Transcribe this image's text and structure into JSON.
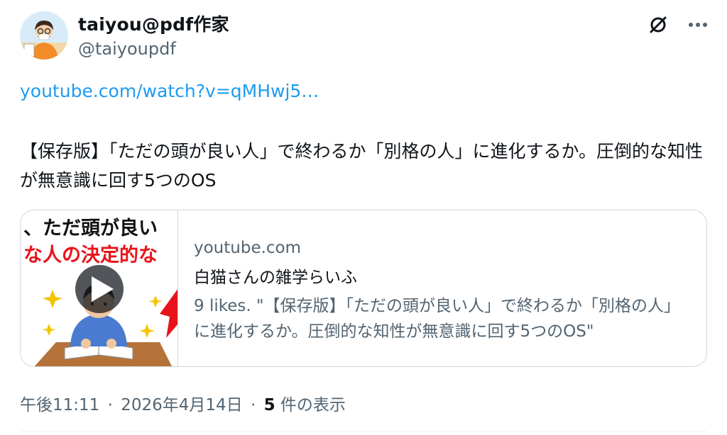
{
  "author": {
    "display_name": "taiyou@pdf作家",
    "handle": "@taiyoupdf"
  },
  "tweet": {
    "link_text": "youtube.com/watch?v=qMHwj5…",
    "text": "【保存版】「ただの頭が良い人」で終わるか「別格の人」に進化するか。圧倒的な知性が無意識に回す5つのOS"
  },
  "card": {
    "thumbnail_text_line1": "、ただ頭が良い",
    "thumbnail_text_line2": "な人の決定的な",
    "domain": "youtube.com",
    "title": "白猫さんの雑学らいふ",
    "description": "9 likes. \"【保存版】「ただの頭が良い人」で終わるか「別格の人」に進化するか。圧倒的な知性が無意識に回す5つのOS\""
  },
  "meta": {
    "time": "午後11:11",
    "separator": "·",
    "date": "2026年4月14日",
    "views_count": "5",
    "views_label": " 件の表示"
  },
  "icons": {
    "grok": "grok-icon",
    "more": "more-icon",
    "play": "play-icon"
  },
  "colors": {
    "link": "#1d9bf0",
    "secondary_text": "#536471",
    "primary_text": "#0f1419",
    "border": "#cfd9de",
    "thumbnail_red": "#e8141b"
  }
}
